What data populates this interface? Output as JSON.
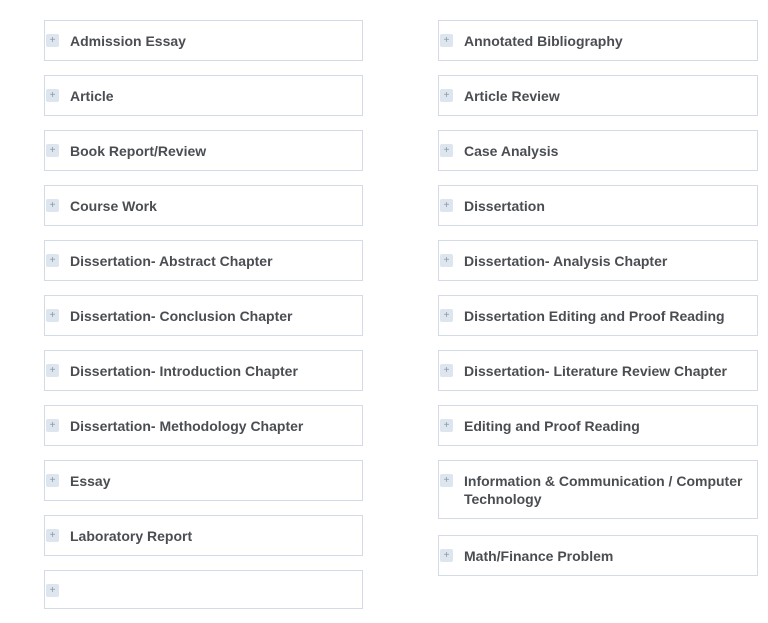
{
  "expand_icon": "+",
  "left_column": [
    {
      "label": "Admission Essay"
    },
    {
      "label": "Article"
    },
    {
      "label": "Book Report/Review"
    },
    {
      "label": "Course Work"
    },
    {
      "label": "Dissertation- Abstract Chapter"
    },
    {
      "label": "Dissertation- Conclusion Chapter"
    },
    {
      "label": "Dissertation- Introduction Chapter"
    },
    {
      "label": "Dissertation- Methodology Chapter"
    },
    {
      "label": "Essay"
    },
    {
      "label": "Laboratory Report"
    },
    {
      "label": ""
    }
  ],
  "right_column": [
    {
      "label": "Annotated Bibliography"
    },
    {
      "label": "Article Review"
    },
    {
      "label": "Case Analysis"
    },
    {
      "label": "Dissertation"
    },
    {
      "label": "Dissertation- Analysis Chapter"
    },
    {
      "label": "Dissertation Editing and Proof Reading"
    },
    {
      "label": "Dissertation- Literature Review Chapter"
    },
    {
      "label": "Editing and Proof Reading"
    },
    {
      "label": "Information & Communication / Computer Technology"
    },
    {
      "label": "Math/Finance Problem"
    }
  ]
}
